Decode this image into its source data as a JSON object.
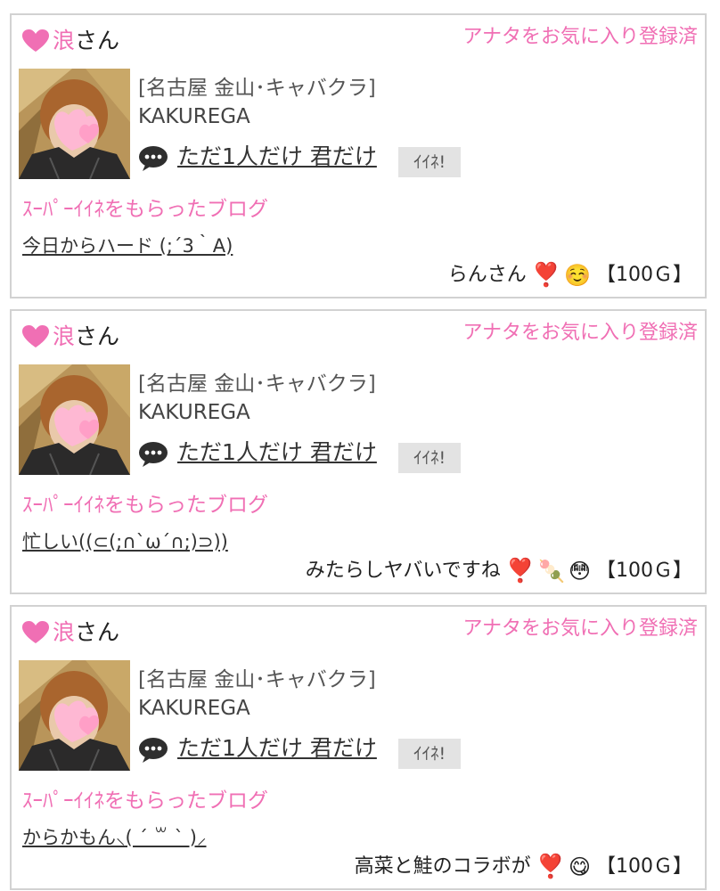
{
  "colors": {
    "pink": "#f06fb4",
    "border": "#d2d2d2",
    "like_bg": "#e3e3e3"
  },
  "cards": [
    {
      "user_name": "浪",
      "user_suffix": "さん",
      "favorite": "アナタをお気に入り登録済",
      "shop_area": "[名古屋 金山･キャバクラ]",
      "shop_name": "KAKUREGA",
      "blog_title": "ただ1人だけ 君だけ",
      "like_label": "ｲｲﾈ!",
      "section_title": "ｽｰﾊﾟｰｲｲﾈをもらったブログ",
      "post_title": "今日からハード (;´3｀A)",
      "comment_text": "らんさん",
      "comment_emojis": [
        "❣️",
        "☺️"
      ],
      "gold": "【100Ｇ】"
    },
    {
      "user_name": "浪",
      "user_suffix": "さん",
      "favorite": "アナタをお気に入り登録済",
      "shop_area": "[名古屋 金山･キャバクラ]",
      "shop_name": "KAKUREGA",
      "blog_title": "ただ1人だけ 君だけ",
      "like_label": "ｲｲﾈ!",
      "section_title": "ｽｰﾊﾟｰｲｲﾈをもらったブログ",
      "post_title": "忙しい((⊂(;∩`ω´∩;)⊃))",
      "comment_text": "みたらしヤバいですね",
      "comment_emojis": [
        "❣️",
        "🍡",
        "😳"
      ],
      "gold": "【100Ｇ】"
    },
    {
      "user_name": "浪",
      "user_suffix": "さん",
      "favorite": "アナタをお気に入り登録済",
      "shop_area": "[名古屋 金山･キャバクラ]",
      "shop_name": "KAKUREGA",
      "blog_title": "ただ1人だけ 君だけ",
      "like_label": "ｲｲﾈ!",
      "section_title": "ｽｰﾊﾟｰｲｲﾈをもらったブログ",
      "post_title": "からかもん⸜( ´ ꒳ ` )⸝",
      "comment_text": "高菜と鮭のコラボが",
      "comment_emojis": [
        "❣️",
        "😋"
      ],
      "gold": "【100Ｇ】"
    }
  ]
}
